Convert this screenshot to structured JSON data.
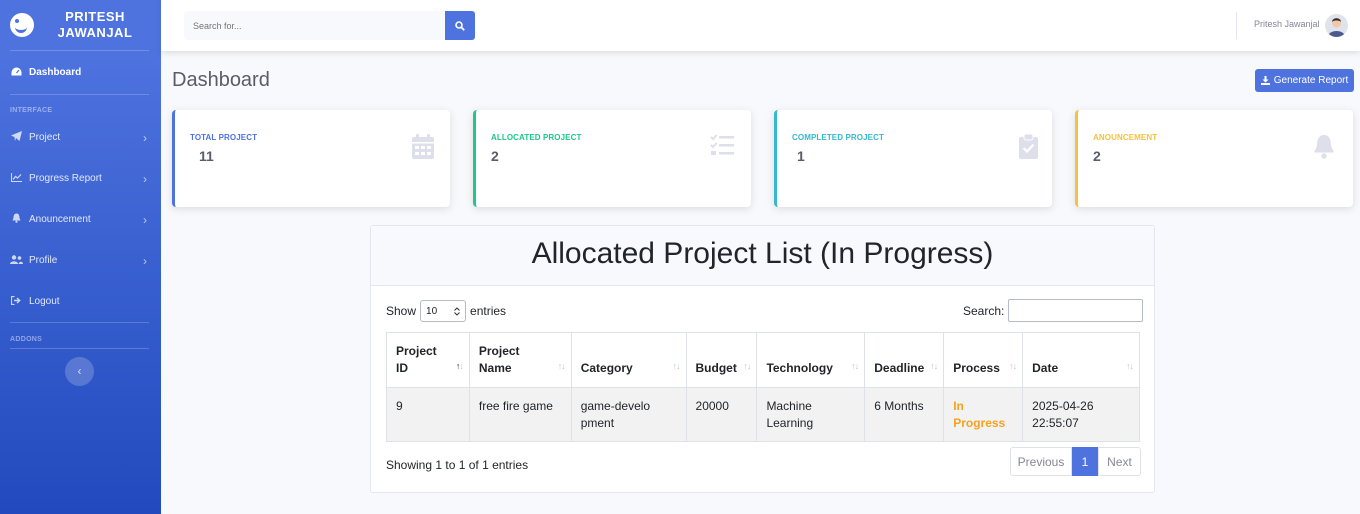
{
  "brand": {
    "name": "PRITESH JAWANJAL"
  },
  "sidebar": {
    "dashboard": "Dashboard",
    "interface_heading": "INTERFACE",
    "items": [
      {
        "label": "Project",
        "icon": "paper-plane-icon"
      },
      {
        "label": "Progress Report",
        "icon": "chart-line-icon"
      },
      {
        "label": "Anouncement",
        "icon": "bell-icon"
      },
      {
        "label": "Profile",
        "icon": "users-icon"
      },
      {
        "label": "Logout",
        "icon": "sign-out-icon"
      }
    ],
    "addons_heading": "ADDONS",
    "toggle_glyph": "‹"
  },
  "topbar": {
    "search_placeholder": "Search for...",
    "user_name": "Pritesh Jawanjal"
  },
  "page": {
    "title": "Dashboard",
    "report_button": "Generate Report"
  },
  "cards": [
    {
      "label": "TOTAL PROJECT",
      "value": "11",
      "color": "#4e73df",
      "icon": "calendar-icon"
    },
    {
      "label": "ALLOCATED PROJECT",
      "value": "2",
      "color": "#1cc88a",
      "icon": "tasks-icon"
    },
    {
      "label": "COMPLETED PROJECT",
      "value": "1",
      "color": "#36b9cc",
      "icon": "clipboard-check-icon"
    },
    {
      "label": "ANOUNCEMENT",
      "value": "2",
      "color": "#f6c23e",
      "icon": "bell-icon"
    }
  ],
  "project_list": {
    "title": "Allocated Project List (In Progress)",
    "show_label": "Show",
    "entries_value": "10",
    "entries_label": "entries",
    "search_label": "Search:",
    "columns": [
      "Project ID",
      "Project Name",
      "Category",
      "Budget",
      "Technology",
      "Deadline",
      "Process",
      "Date"
    ],
    "rows": [
      {
        "id": "9",
        "name": "free fire game",
        "category": "game-development",
        "budget": "20000",
        "technology": "Machine Learning",
        "deadline": "6 Months",
        "process": "In Progress",
        "date": "2025-04-26 22:55:07"
      }
    ],
    "info": "Showing 1 to 1 of 1 entries",
    "pagination": {
      "previous": "Previous",
      "current": "1",
      "next": "Next"
    }
  }
}
